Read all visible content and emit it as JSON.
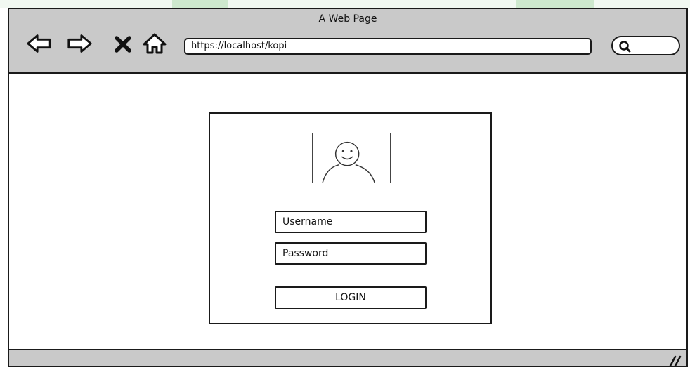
{
  "window": {
    "title": "A Web Page"
  },
  "toolbar": {
    "back_icon": "left-arrow-icon",
    "forward_icon": "right-arrow-icon",
    "stop_icon": "x-icon",
    "home_icon": "home-icon",
    "address": "https://localhost/kopi",
    "search_icon": "search-icon"
  },
  "login": {
    "avatar_icon": "user-avatar-icon",
    "username_placeholder": "Username",
    "password_placeholder": "Password",
    "button_label": "LOGIN"
  },
  "colors": {
    "chrome_gray": "#c9c9c9",
    "outline": "#1a1a1a",
    "background_accent": "#cde8cd"
  }
}
